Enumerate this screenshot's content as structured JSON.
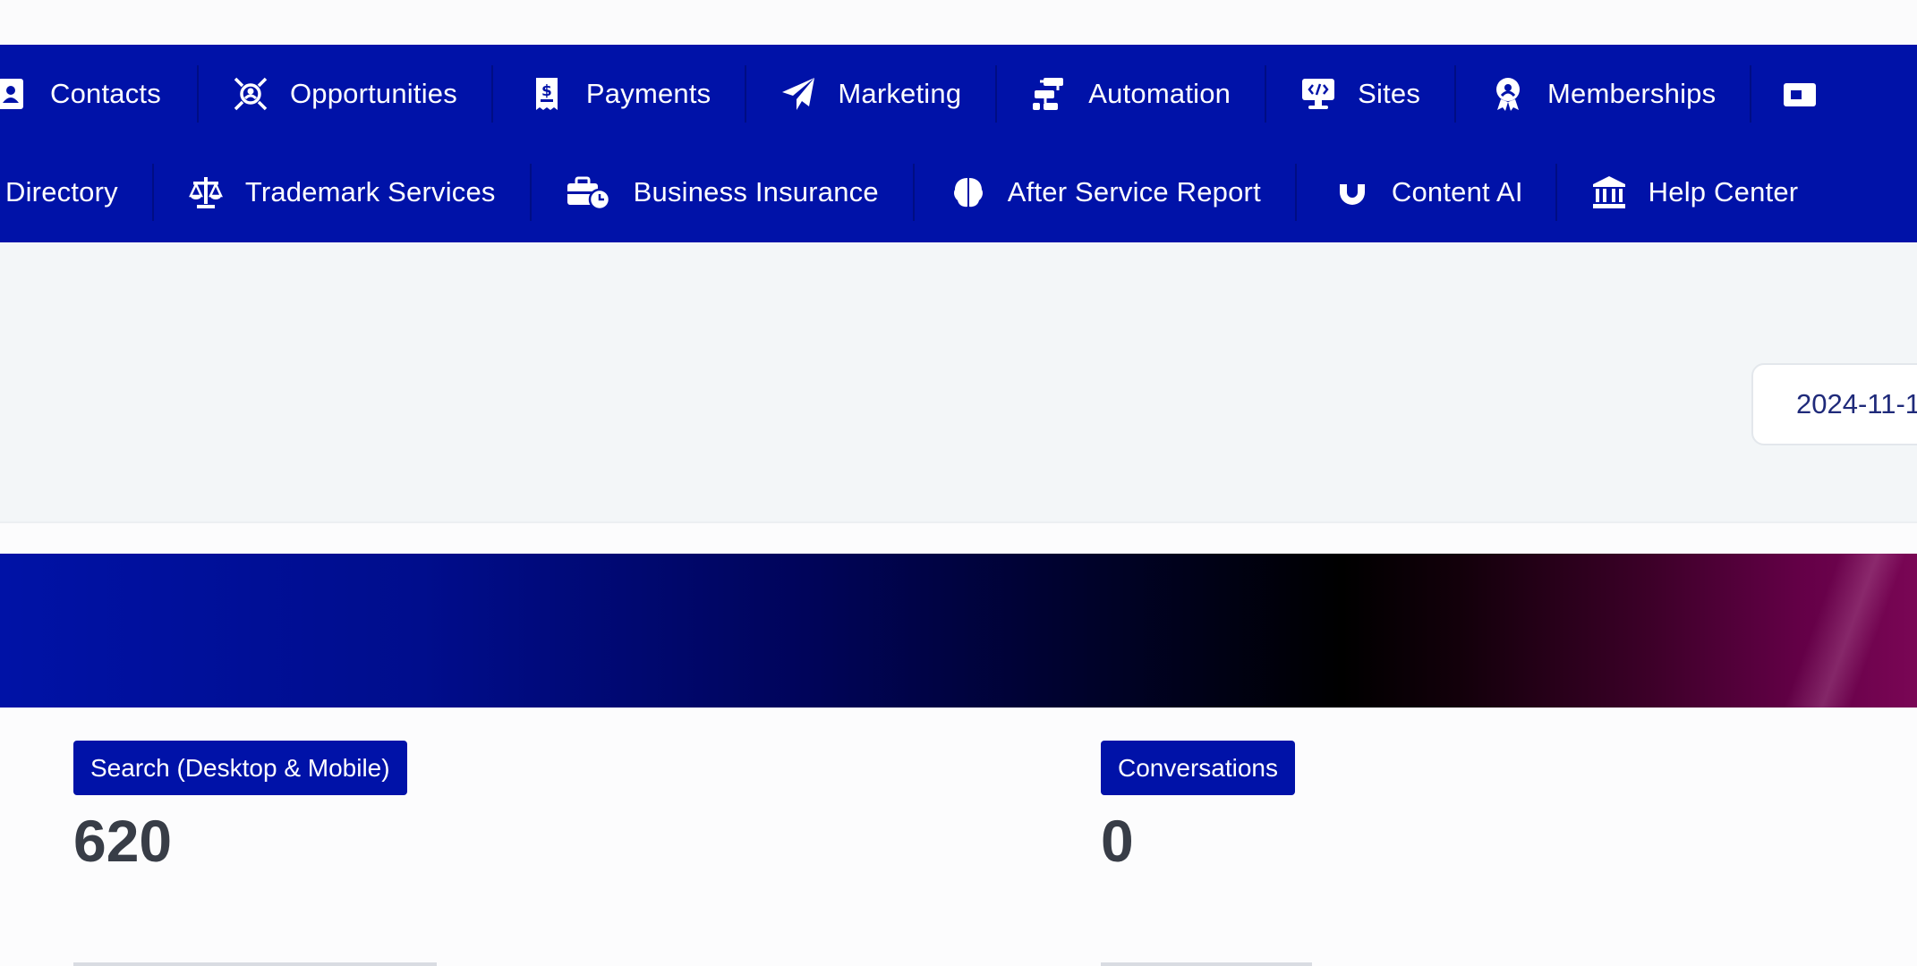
{
  "nav": {
    "row1": [
      {
        "label": "Contacts",
        "icon": "contact-book-icon"
      },
      {
        "label": "Opportunities",
        "icon": "target-user-icon"
      },
      {
        "label": "Payments",
        "icon": "receipt-dollar-icon"
      },
      {
        "label": "Marketing",
        "icon": "paper-plane-icon"
      },
      {
        "label": "Automation",
        "icon": "workflow-icon"
      },
      {
        "label": "Sites",
        "icon": "monitor-code-icon"
      },
      {
        "label": "Memberships",
        "icon": "award-badge-icon"
      }
    ],
    "row2": [
      {
        "label": "Directory"
      },
      {
        "label": "Trademark Services",
        "icon": "scale-icon"
      },
      {
        "label": "Business Insurance",
        "icon": "briefcase-clock-icon"
      },
      {
        "label": "After Service Report",
        "icon": "brain-icon"
      },
      {
        "label": "Content AI",
        "icon": "magnet-icon"
      },
      {
        "label": "Help Center",
        "icon": "bank-building-icon"
      }
    ]
  },
  "filter": {
    "date_text": "2024-11-1"
  },
  "stats": [
    {
      "label": "Search (Desktop & Mobile)",
      "value": "620"
    },
    {
      "label": "Conversations",
      "value": "0"
    }
  ],
  "colors": {
    "nav_bg": "#0012a8",
    "badge_bg": "#0012a8",
    "filter_bg": "#f3f6f8",
    "value_text": "#383d47",
    "date_text": "#1f2a7a"
  }
}
